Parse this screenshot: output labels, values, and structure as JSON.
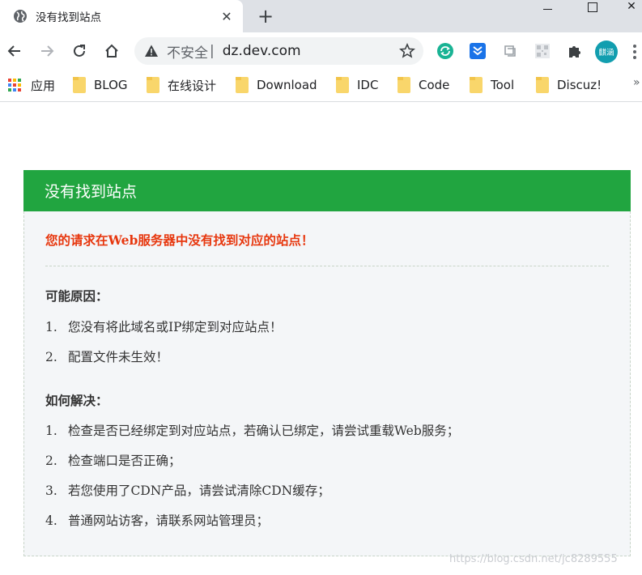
{
  "browser": {
    "tab": {
      "title": "没有找到站点"
    },
    "new_tab_label": "+",
    "window": {
      "close_label": "✕"
    },
    "omnibox": {
      "security_label": "不安全",
      "separator": "|",
      "url": "dz.dev.com"
    },
    "profile": {
      "avatar_label": "麒涵"
    },
    "bookmarks": [
      {
        "label": "应用",
        "icon": "apps-grid-icon"
      },
      {
        "label": "BLOG",
        "icon": "folder-icon"
      },
      {
        "label": "在线设计",
        "icon": "folder-icon"
      },
      {
        "label": "Download",
        "icon": "folder-icon"
      },
      {
        "label": "IDC",
        "icon": "folder-icon"
      },
      {
        "label": "Code",
        "icon": "folder-icon"
      },
      {
        "label": "Tool",
        "icon": "folder-icon"
      },
      {
        "label": "Discuz!",
        "icon": "folder-icon"
      }
    ],
    "bookmarks_more": "»"
  },
  "page": {
    "header_title": "没有找到站点",
    "error_message": "您的请求在Web服务器中没有找到对应的站点！",
    "reasons": {
      "title": "可能原因：",
      "items": [
        {
          "num": "1.",
          "text": "您没有将此域名或IP绑定到对应站点！"
        },
        {
          "num": "2.",
          "text": "配置文件未生效！"
        }
      ]
    },
    "solutions": {
      "title": "如何解决：",
      "items": [
        {
          "num": "1.",
          "text": "检查是否已经绑定到对应站点，若确认已绑定，请尝试重载Web服务；"
        },
        {
          "num": "2.",
          "text": "检查端口是否正确；"
        },
        {
          "num": "3.",
          "text": "若您使用了CDN产品，请尝试清除CDN缓存；"
        },
        {
          "num": "4.",
          "text": "普通网站访客，请联系网站管理员；"
        }
      ]
    }
  },
  "watermark": "https://blog.csdn.net/jc8289555",
  "colors": {
    "header_green": "#21a540",
    "error_red": "#e7370e",
    "body_bg": "#f4f6f8"
  }
}
